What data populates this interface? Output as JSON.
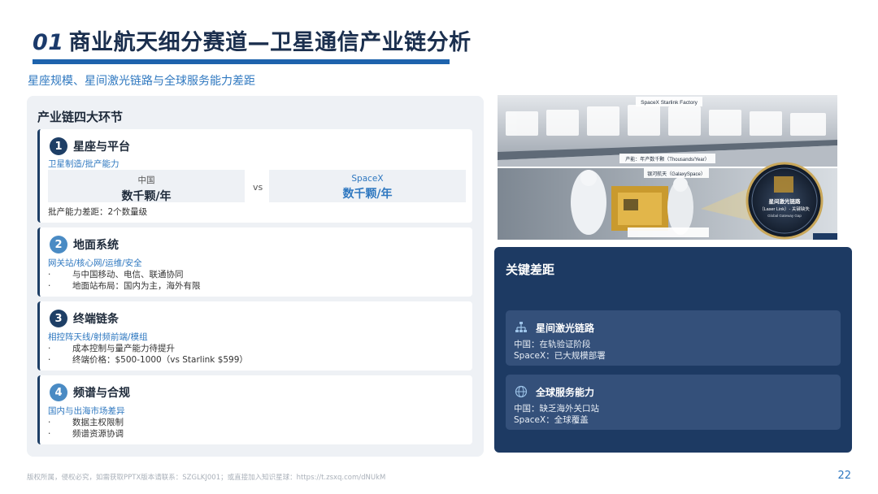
{
  "header": {
    "number": "01",
    "title": "商业航天细分赛道—卫星通信产业链分析",
    "subtitle": "星座规模、星间激光链路与全球服务能力差距"
  },
  "left": {
    "title": "产业链四大环节",
    "cards": [
      {
        "num": "1",
        "title": "星座与平台",
        "sub": "卫星制造/批产能力",
        "compare": {
          "china_label": "中国",
          "china_value": "数千颗/年",
          "vs": "vs",
          "spacex_label": "SpaceX",
          "spacex_value": "数千颗/年"
        },
        "gap": "批产能力差距：2个数量级"
      },
      {
        "num": "2",
        "title": "地面系统",
        "sub": "网关站/核心网/运维/安全",
        "bullets": [
          "与中国移动、电信、联通协同",
          "地面站布局：国内为主，海外有限"
        ]
      },
      {
        "num": "3",
        "title": "终端链条",
        "sub": "相控阵天线/射频前端/模组",
        "bullets": [
          "成本控制与量产能力待提升",
          "终端价格：$500-1000（vs Starlink $599）"
        ]
      },
      {
        "num": "4",
        "title": "频谱与合规",
        "sub": "国内与出海市场差异",
        "bullets": [
          "数据主权限制",
          "频谱资源协调"
        ]
      }
    ]
  },
  "photo": {
    "label_factory": "SpaceX Starlink Factory",
    "label_prod_thousands": "产能：年产数千颗（Thousands/Year）",
    "label_galaxy": "银河航天（GalaxySpace）",
    "label_prod_dozens": "产能：年产数十颗（Dozens/Year）",
    "label_laser_1": "星间激光链路",
    "label_laser_2": "（Laser Link）- 关键缺失",
    "label_laser_3": "Global Gateway Gap"
  },
  "right": {
    "title": "关键差距",
    "items": [
      {
        "icon": "network-icon",
        "title": "星间激光链路",
        "china": "中国：在轨验证阶段",
        "spacex": "SpaceX：已大规模部署"
      },
      {
        "icon": "globe-icon",
        "title": "全球服务能力",
        "china": "中国：缺乏海外关口站",
        "spacex": "SpaceX：全球覆盖"
      }
    ]
  },
  "footer": {
    "text": "版权所属，侵权必究，如需获取PPTX版本请联系：SZGLKJ001；或直接加入知识星球：https://t.zsxq.com/dNUkM",
    "page": "22"
  },
  "colors": {
    "navy": "#1d3a63",
    "accent_blue": "#1e63ad",
    "link_blue": "#2f78c0",
    "panel_gray": "#eef1f5"
  }
}
